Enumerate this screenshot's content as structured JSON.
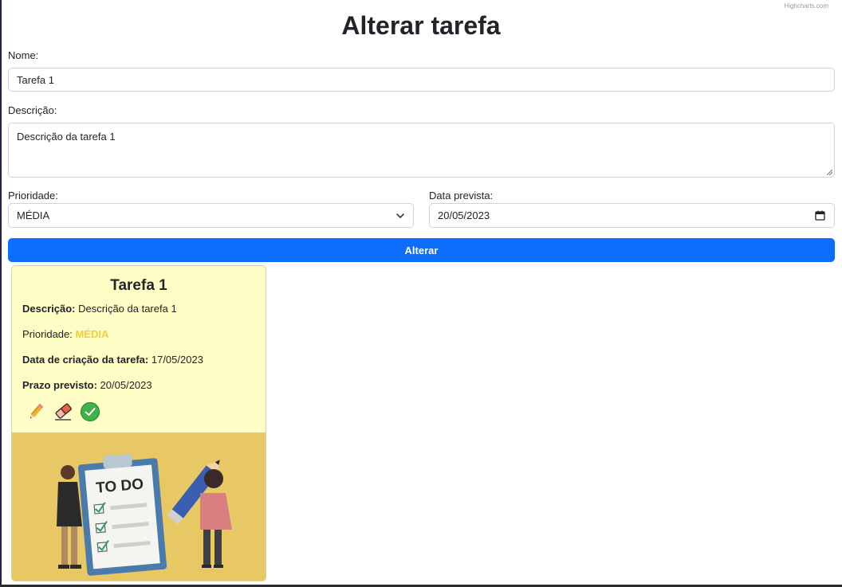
{
  "credit": "Highcharts.com",
  "title": "Alterar tarefa",
  "form": {
    "name_label": "Nome:",
    "name_value": "Tarefa 1",
    "desc_label": "Descrição:",
    "desc_value": "Descrição da tarefa 1",
    "priority_label": "Prioridade:",
    "priority_value": "MÉDIA",
    "date_label": "Data prevista:",
    "date_value": "20/05/2023",
    "submit_label": "Alterar"
  },
  "card": {
    "title": "Tarefa 1",
    "desc_label": "Descrição:",
    "desc_value": "Descrição da tarefa 1",
    "priority_label": "Prioridade:",
    "priority_value": "MÉDIA",
    "created_label": "Data de criação da tarefa:",
    "created_value": "17/05/2023",
    "deadline_label": "Prazo previsto:",
    "deadline_value": "20/05/2023",
    "priority_color": "#f5cc3a",
    "background_color": "#fffdc6",
    "icons": [
      "pencil-icon",
      "eraser-icon",
      "check-circle-icon"
    ],
    "illustration_text": "TO DO"
  },
  "colors": {
    "primary": "#0d6efd"
  }
}
